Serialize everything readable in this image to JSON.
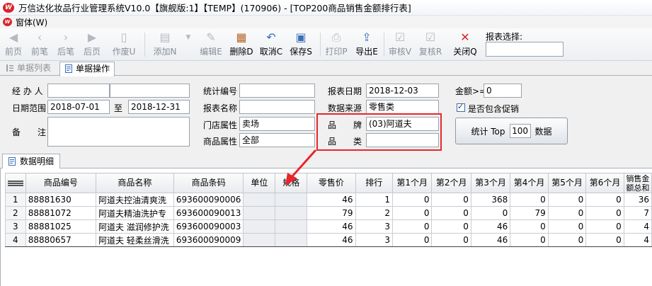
{
  "window": {
    "title": "万信达化妆品行业管理系统V10.0【旗舰版:1】【TEMP】(170906) - [TOP200商品销售金额排行表]"
  },
  "menu": {
    "items": [
      "窗体(W)"
    ]
  },
  "toolbar": {
    "buttons": [
      {
        "label": "前页",
        "icon": "first-page-icon",
        "enabled": false
      },
      {
        "label": "前笔",
        "icon": "prev-record-icon",
        "enabled": false
      },
      {
        "label": "后笔",
        "icon": "next-record-icon",
        "enabled": false
      },
      {
        "label": "后页",
        "icon": "last-page-icon",
        "enabled": false
      },
      {
        "label": "作废U",
        "icon": "void-icon",
        "enabled": false
      },
      {
        "label": "添加N",
        "icon": "add-icon",
        "enabled": false
      },
      {
        "label": "编辑E",
        "icon": "edit-icon",
        "enabled": false
      },
      {
        "label": "删除D",
        "icon": "delete-icon",
        "enabled": true
      },
      {
        "label": "取消C",
        "icon": "undo-icon",
        "enabled": true
      },
      {
        "label": "保存S",
        "icon": "save-icon",
        "enabled": true
      },
      {
        "label": "打印P",
        "icon": "print-icon",
        "enabled": false
      },
      {
        "label": "导出E",
        "icon": "export-icon",
        "enabled": true
      },
      {
        "label": "审核V",
        "icon": "approve-icon",
        "enabled": false
      },
      {
        "label": "复核R",
        "icon": "recheck-icon",
        "enabled": false
      },
      {
        "label": "关闭Q",
        "icon": "close-icon",
        "enabled": true
      }
    ],
    "report_select_label": "报表选择:",
    "report_select_value": ""
  },
  "tabs": {
    "list": "单据列表",
    "ops": "单据操作"
  },
  "form": {
    "handler_label": "经 办 人",
    "handler_value": "",
    "handler_value2": "",
    "date_range_label": "日期范围",
    "date_from": "2018-07-01",
    "date_to_label": "至",
    "date_to": "2018-12-31",
    "remark_label": "备　　注",
    "remark_value": "",
    "stat_no_label": "统计编号",
    "stat_no_value": "",
    "report_name_label": "报表名称",
    "report_name_value": "",
    "store_attr_label": "门店属性",
    "store_attr_value": "卖场",
    "product_attr_label": "商品属性",
    "product_attr_value": "全部",
    "report_date_label": "报表日期",
    "report_date_value": "2018-12-03",
    "data_source_label": "数据来源",
    "data_source_value": "零售类",
    "brand_label": "品　　牌",
    "brand_value": "(03)阿道夫",
    "category_label": "品　　类",
    "category_value": "",
    "amount_label": "金额>=",
    "amount_value": "0",
    "include_promo_label": "是否包含促销",
    "include_promo_checked": true,
    "stat_button_prefix": "统计 Top",
    "stat_button_top": "100",
    "stat_button_suffix": "数据"
  },
  "data_tab": "数据明细",
  "grid": {
    "columns": [
      "商品编号",
      "商品名称",
      "商品条码",
      "单位",
      "规格",
      "零售价",
      "排行",
      "第1个月",
      "第2个月",
      "第3个月",
      "第4个月",
      "第5个月",
      "第6个月",
      "销售金额总和"
    ],
    "rows": [
      {
        "no": "1",
        "code": "88881630",
        "name": "阿道夫控油清爽洗",
        "barcode": "693600090006",
        "unit": "",
        "spec": "",
        "price": "46",
        "rank": "1",
        "m1": "0",
        "m2": "0",
        "m3": "368",
        "m4": "0",
        "m5": "0",
        "m6": "0",
        "total": "36"
      },
      {
        "no": "2",
        "code": "88881072",
        "name": "阿道夫精油洗护专",
        "barcode": "693600090013",
        "unit": "",
        "spec": "",
        "price": "79",
        "rank": "2",
        "m1": "0",
        "m2": "0",
        "m3": "0",
        "m4": "79",
        "m5": "0",
        "m6": "0",
        "total": "7"
      },
      {
        "no": "3",
        "code": "88881025",
        "name": "阿道夫 滋润修护洗",
        "barcode": "693600090003",
        "unit": "",
        "spec": "",
        "price": "46",
        "rank": "3",
        "m1": "0",
        "m2": "0",
        "m3": "46",
        "m4": "0",
        "m5": "0",
        "m6": "0",
        "total": "4"
      },
      {
        "no": "4",
        "code": "88880657",
        "name": "阿道夫 轻柔丝滑洗",
        "barcode": "693600090009",
        "unit": "",
        "spec": "",
        "price": "46",
        "rank": "3",
        "m1": "0",
        "m2": "0",
        "m3": "46",
        "m4": "0",
        "m5": "0",
        "m6": "0",
        "total": "4"
      }
    ]
  },
  "colors": {
    "highlight_red": "#e8262b",
    "toolbar_blue": "#3a70b8"
  }
}
